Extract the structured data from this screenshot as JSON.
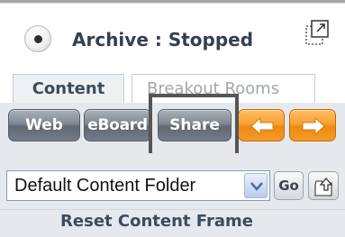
{
  "archive": {
    "status_text": "Archive : Stopped",
    "radio_icon": "radio-button-icon"
  },
  "popout": {
    "icon": "popout-window-icon"
  },
  "tabs": [
    {
      "label": "Content",
      "active": true
    },
    {
      "label": "Breakout Rooms",
      "active": false
    }
  ],
  "toolbar": {
    "web_label": "Web",
    "eboard_label": "eBoard",
    "share_label": "Share",
    "back_icon": "arrow-left-icon",
    "forward_icon": "arrow-right-icon"
  },
  "folder": {
    "selected": "Default Content Folder",
    "go_label": "Go",
    "up_icon": "folder-up-icon"
  },
  "reset": {
    "label": "Reset Content Frame"
  },
  "colors": {
    "accent_orange": "#f7a133",
    "toolbar_bg": "#e5e9ee",
    "text_dark": "#3c4b5d",
    "highlight": "#555555"
  }
}
